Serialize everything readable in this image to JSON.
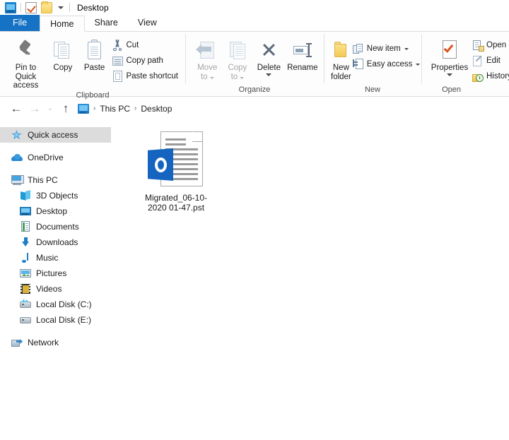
{
  "window": {
    "title": "Desktop",
    "quick_access_toolbar": [
      {
        "name": "explorer-icon",
        "label": "File Explorer"
      },
      {
        "name": "properties-icon",
        "label": "Properties"
      },
      {
        "name": "new-folder-icon",
        "label": "New folder"
      },
      {
        "name": "customize-caret-icon",
        "label": "Customize Quick Access Toolbar"
      }
    ]
  },
  "tabs": [
    {
      "label": "File",
      "id": "file"
    },
    {
      "label": "Home",
      "id": "home"
    },
    {
      "label": "Share",
      "id": "share"
    },
    {
      "label": "View",
      "id": "view"
    }
  ],
  "ribbon": {
    "groups": [
      {
        "label": "Clipboard",
        "big_buttons": [
          {
            "label": "Pin to Quick\naccess",
            "line1": "Pin to Quick",
            "line2": "access",
            "icon": "pin-icon",
            "disabled": false
          },
          {
            "label": "Copy",
            "line1": "Copy",
            "line2": "",
            "icon": "copy-icon",
            "disabled": false
          },
          {
            "label": "Paste",
            "line1": "Paste",
            "line2": "",
            "icon": "paste-icon",
            "disabled": false
          }
        ],
        "small_buttons": [
          {
            "label": "Cut",
            "icon": "scissors-icon",
            "disabled": false,
            "caret": false
          },
          {
            "label": "Copy path",
            "icon": "copy-path-icon",
            "disabled": false,
            "caret": false
          },
          {
            "label": "Paste shortcut",
            "icon": "paste-shortcut-icon",
            "disabled": false,
            "caret": false
          }
        ]
      },
      {
        "label": "Organize",
        "big_buttons": [
          {
            "line1": "Move",
            "line2": "to",
            "icon": "move-to-icon",
            "disabled": true,
            "caret": true
          },
          {
            "line1": "Copy",
            "line2": "to",
            "icon": "copy-to-icon",
            "disabled": true,
            "caret": true
          },
          {
            "line1": "Delete",
            "line2": "",
            "icon": "delete-icon",
            "disabled": false,
            "caret": true
          },
          {
            "line1": "Rename",
            "line2": "",
            "icon": "rename-icon",
            "disabled": false,
            "caret": false
          }
        ],
        "small_buttons": []
      },
      {
        "label": "New",
        "big_buttons": [
          {
            "line1": "New",
            "line2": "folder",
            "icon": "new-folder-icon",
            "disabled": false,
            "caret": false
          }
        ],
        "small_buttons": [
          {
            "label": "New item",
            "icon": "new-item-icon",
            "disabled": false,
            "caret": true
          },
          {
            "label": "Easy access",
            "icon": "easy-access-icon",
            "disabled": false,
            "caret": true
          }
        ]
      },
      {
        "label": "Open",
        "big_buttons": [
          {
            "line1": "Properties",
            "line2": "",
            "icon": "properties-icon",
            "disabled": false,
            "caret": true
          }
        ],
        "small_buttons": [
          {
            "label": "Open",
            "icon": "open-icon",
            "disabled": false,
            "caret": true
          },
          {
            "label": "Edit",
            "icon": "edit-icon",
            "disabled": false,
            "caret": false
          },
          {
            "label": "History",
            "icon": "history-icon",
            "disabled": false,
            "caret": false
          }
        ]
      }
    ]
  },
  "address_bar": {
    "back": "←",
    "forward": "→",
    "recent": "⌄",
    "up": "↑",
    "back_enabled": true,
    "forward_enabled": false,
    "breadcrumbs": [
      "This PC",
      "Desktop"
    ],
    "separator": "›"
  },
  "sidebar": {
    "items": [
      {
        "label": "Quick access",
        "icon": "star-icon",
        "indent": false,
        "selected": true,
        "space_before": false
      },
      {
        "label": "OneDrive",
        "icon": "cloud-icon",
        "indent": false,
        "selected": false,
        "space_before": true
      },
      {
        "label": "This PC",
        "icon": "this-pc-icon",
        "indent": false,
        "selected": false,
        "space_before": true
      },
      {
        "label": "3D Objects",
        "icon": "3d-objects-icon",
        "indent": true,
        "selected": false,
        "space_before": false
      },
      {
        "label": "Desktop",
        "icon": "desktop-icon",
        "indent": true,
        "selected": false,
        "space_before": false
      },
      {
        "label": "Documents",
        "icon": "documents-icon",
        "indent": true,
        "selected": false,
        "space_before": false
      },
      {
        "label": "Downloads",
        "icon": "downloads-icon",
        "indent": true,
        "selected": false,
        "space_before": false
      },
      {
        "label": "Music",
        "icon": "music-icon",
        "indent": true,
        "selected": false,
        "space_before": false
      },
      {
        "label": "Pictures",
        "icon": "pictures-icon",
        "indent": true,
        "selected": false,
        "space_before": false
      },
      {
        "label": "Videos",
        "icon": "videos-icon",
        "indent": true,
        "selected": false,
        "space_before": false
      },
      {
        "label": "Local Disk (C:)",
        "icon": "local-disk-c-icon",
        "indent": true,
        "selected": false,
        "space_before": false
      },
      {
        "label": "Local Disk (E:)",
        "icon": "local-disk-e-icon",
        "indent": true,
        "selected": false,
        "space_before": false
      },
      {
        "label": "Network",
        "icon": "network-icon",
        "indent": false,
        "selected": false,
        "space_before": true
      }
    ]
  },
  "content": {
    "files": [
      {
        "name": "Migrated_06-10-2020 01-47.pst",
        "icon": "outlook-pst-file-icon",
        "selected": false
      }
    ]
  },
  "colors": {
    "accent": "#1572c4",
    "ribbon_bg": "#fdfdfd",
    "selection": "#dcdcdc",
    "outlook_blue": "#1565c0"
  }
}
